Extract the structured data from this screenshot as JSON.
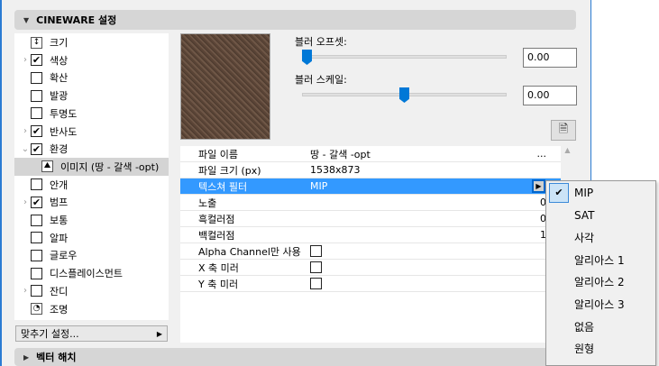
{
  "sections": {
    "cineware": "CINEWARE 설정",
    "vector_hatch": "벡터 해치"
  },
  "channels": [
    {
      "label": "크기",
      "icon": "size-icon"
    },
    {
      "label": "색상",
      "checked": true,
      "expand": "collapsed"
    },
    {
      "label": "확산",
      "checked": false
    },
    {
      "label": "발광",
      "checked": false
    },
    {
      "label": "투명도",
      "checked": false
    },
    {
      "label": "반사도",
      "checked": true,
      "expand": "collapsed"
    },
    {
      "label": "환경",
      "checked": true,
      "expand": "expanded"
    },
    {
      "label": "이미지 (땅 - 갈색 -opt)",
      "icon": "image-icon",
      "selected": true
    },
    {
      "label": "안개",
      "checked": false
    },
    {
      "label": "범프",
      "checked": true,
      "expand": "collapsed"
    },
    {
      "label": "보통",
      "checked": false
    },
    {
      "label": "알파",
      "checked": false
    },
    {
      "label": "글로우",
      "checked": false
    },
    {
      "label": "디스플레이스먼트",
      "checked": false
    },
    {
      "label": "잔디",
      "checked": false,
      "expand": "collapsed"
    },
    {
      "label": "조명",
      "icon": "light-icon"
    }
  ],
  "fit_settings": "맞추기 설정...",
  "blur": {
    "offset_label": "블러 오프셋:",
    "offset_value": "0.00",
    "offset_slider": 0.0,
    "scale_label": "블러 스케일:",
    "scale_value": "0.00",
    "scale_slider": 0.5
  },
  "properties": [
    {
      "key": "파일 이름",
      "value": "땅 - 갈색 -opt",
      "right": "..."
    },
    {
      "key": "파일 크기 (px)",
      "value": "1538x873"
    },
    {
      "key": "텍스쳐 필터",
      "value": "MIP",
      "selected": true
    },
    {
      "key": "노출",
      "right": "0"
    },
    {
      "key": "흑컬러점",
      "right": "0"
    },
    {
      "key": "백컬러점",
      "right": "1"
    },
    {
      "key": "Alpha Channel만 사용",
      "checkbox": true
    },
    {
      "key": "X 축 미러",
      "checkbox": true
    },
    {
      "key": "Y 축 미러",
      "checkbox": true
    }
  ],
  "filter_menu": {
    "selected": "MIP",
    "options": [
      "MIP",
      "SAT",
      "사각",
      "알리아스 1",
      "알리아스 2",
      "알리아스 3",
      "없음",
      "원형"
    ]
  }
}
